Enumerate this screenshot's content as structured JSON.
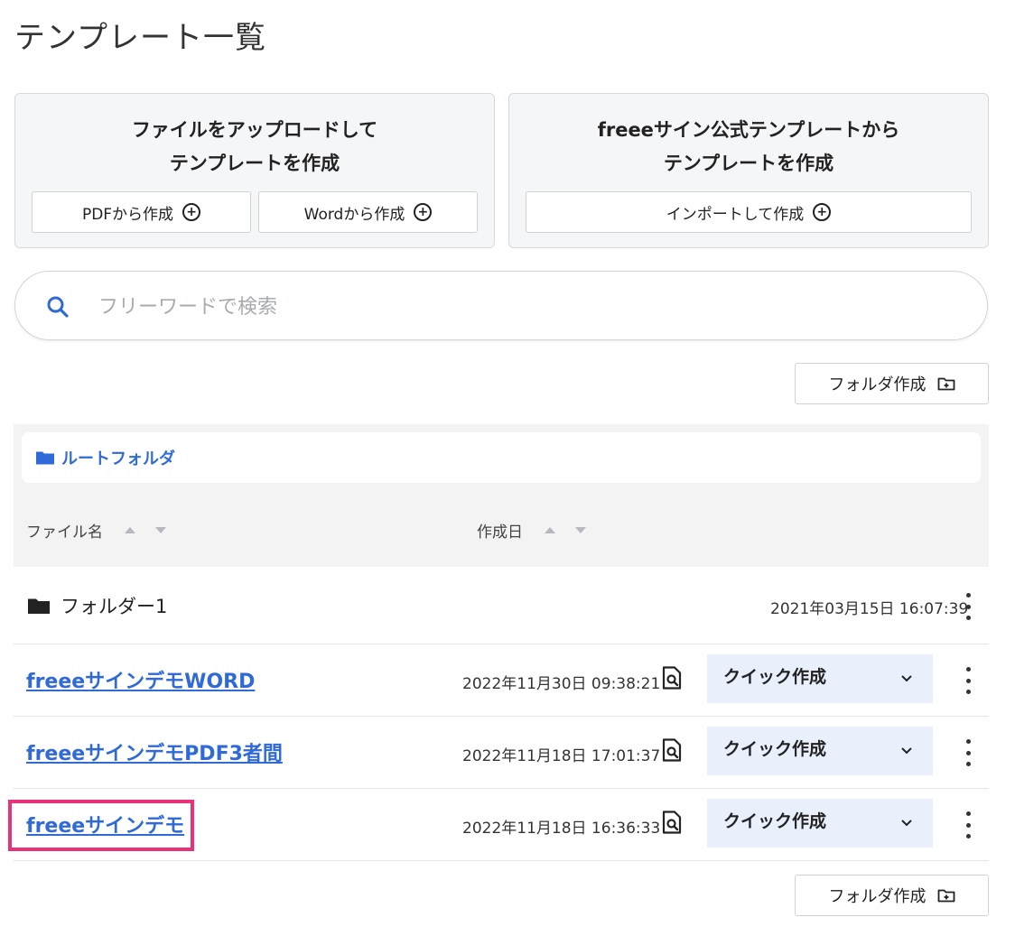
{
  "page_title": "テンプレート一覧",
  "upload_card": {
    "title_line1": "ファイルをアップロードして",
    "title_line2": "テンプレートを作成",
    "pdf_button": "PDFから作成",
    "word_button": "Wordから作成"
  },
  "official_card": {
    "title_line1": "freeeサイン公式テンプレートから",
    "title_line2": "テンプレートを作成",
    "import_button": "インポートして作成"
  },
  "search": {
    "placeholder": "フリーワードで検索"
  },
  "folder_create_label": "フォルダ作成",
  "breadcrumb": "ルートフォルダ",
  "columns": {
    "name": "ファイル名",
    "created": "作成日"
  },
  "folders": [
    {
      "name": "フォルダー1",
      "date": "2021年03月15日 16:07:39"
    }
  ],
  "files": [
    {
      "name": "freeeサインデモWORD",
      "date": "2022年11月30日 09:38:21",
      "action": "クイック作成"
    },
    {
      "name": "freeeサインデモPDF3者間",
      "date": "2022年11月18日 17:01:37",
      "action": "クイック作成"
    },
    {
      "name": "freeeサインデモ",
      "date": "2022年11月18日 16:36:33",
      "action": "クイック作成"
    }
  ],
  "colors": {
    "link": "#2f6ad8",
    "quick_bg": "#e9f0fb",
    "highlight": "#e8337a"
  }
}
